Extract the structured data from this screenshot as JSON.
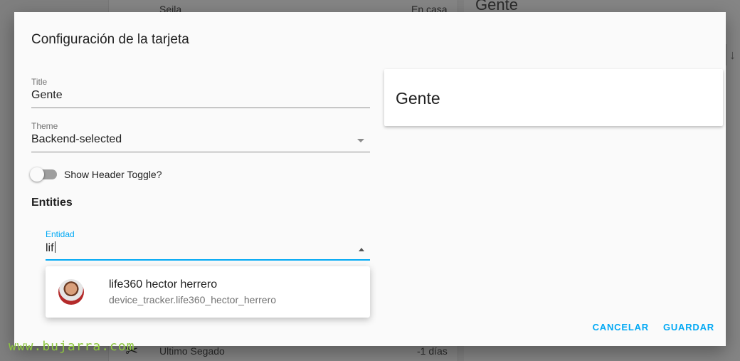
{
  "background": {
    "rows": [
      {
        "name": "Seila",
        "state": "En casa"
      },
      {
        "name": "Ultimo Segado",
        "state": "-1 días"
      }
    ],
    "right_card_title": "Gente",
    "arrow_glyph": "↓"
  },
  "dialog": {
    "title": "Configuración de la tarjeta",
    "title_field": {
      "label": "Title",
      "value": "Gente"
    },
    "theme_field": {
      "label": "Theme",
      "value": "Backend-selected"
    },
    "header_toggle": {
      "label": "Show Header Toggle?",
      "checked": false
    },
    "entities_heading": "Entities",
    "entity_field": {
      "label": "Entidad",
      "value": "lif"
    },
    "suggestion": {
      "primary": "life360 hector herrero",
      "secondary": "device_tracker.life360_hector_herrero"
    },
    "preview": {
      "title": "Gente"
    },
    "actions": {
      "cancel": "CANCELAR",
      "save": "GUARDAR"
    }
  },
  "watermark": "www.bujarra.com",
  "colors": {
    "accent": "#03a9f4",
    "watermark": "#8dc63f"
  }
}
